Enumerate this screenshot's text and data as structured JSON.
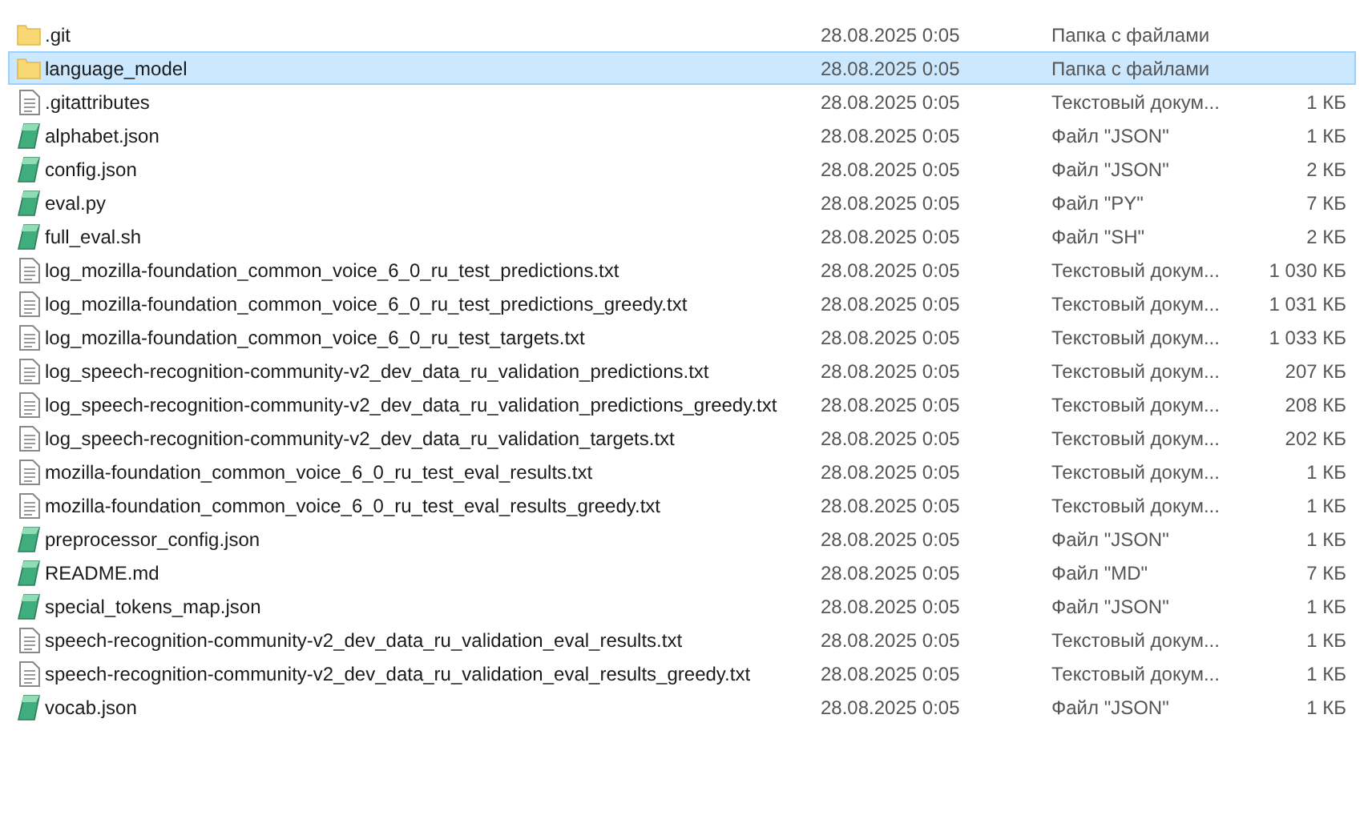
{
  "files": [
    {
      "kind": "folder",
      "name": ".git",
      "date": "28.08.2025 0:05",
      "type": "Папка с файлами",
      "selected": false
    },
    {
      "kind": "folder",
      "name": "language_model",
      "date": "28.08.2025 0:05",
      "type": "Папка с файлами",
      "selected": true
    },
    {
      "kind": "text",
      "name": ".gitattributes",
      "date": "28.08.2025 0:05",
      "type": "Текстовый докум...",
      "size": "1 КБ",
      "selected": false
    },
    {
      "kind": "script",
      "name": "alphabet.json",
      "date": "28.08.2025 0:05",
      "type": "Файл \"JSON\"",
      "size": "1 КБ",
      "selected": false
    },
    {
      "kind": "script",
      "name": "config.json",
      "date": "28.08.2025 0:05",
      "type": "Файл \"JSON\"",
      "size": "2 КБ",
      "selected": false
    },
    {
      "kind": "script",
      "name": "eval.py",
      "date": "28.08.2025 0:05",
      "type": "Файл \"PY\"",
      "size": "7 КБ",
      "selected": false
    },
    {
      "kind": "script",
      "name": "full_eval.sh",
      "date": "28.08.2025 0:05",
      "type": "Файл \"SH\"",
      "size": "2 КБ",
      "selected": false
    },
    {
      "kind": "text",
      "name": "log_mozilla-foundation_common_voice_6_0_ru_test_predictions.txt",
      "date": "28.08.2025 0:05",
      "type": "Текстовый докум...",
      "size": "1 030 КБ",
      "selected": false
    },
    {
      "kind": "text",
      "name": "log_mozilla-foundation_common_voice_6_0_ru_test_predictions_greedy.txt",
      "date": "28.08.2025 0:05",
      "type": "Текстовый докум...",
      "size": "1 031 КБ",
      "selected": false
    },
    {
      "kind": "text",
      "name": "log_mozilla-foundation_common_voice_6_0_ru_test_targets.txt",
      "date": "28.08.2025 0:05",
      "type": "Текстовый докум...",
      "size": "1 033 КБ",
      "selected": false
    },
    {
      "kind": "text",
      "name": "log_speech-recognition-community-v2_dev_data_ru_validation_predictions.txt",
      "date": "28.08.2025 0:05",
      "type": "Текстовый докум...",
      "size": "207 КБ",
      "selected": false
    },
    {
      "kind": "text",
      "name": "log_speech-recognition-community-v2_dev_data_ru_validation_predictions_greedy.txt",
      "date": "28.08.2025 0:05",
      "type": "Текстовый докум...",
      "size": "208 КБ",
      "selected": false
    },
    {
      "kind": "text",
      "name": "log_speech-recognition-community-v2_dev_data_ru_validation_targets.txt",
      "date": "28.08.2025 0:05",
      "type": "Текстовый докум...",
      "size": "202 КБ",
      "selected": false
    },
    {
      "kind": "text",
      "name": "mozilla-foundation_common_voice_6_0_ru_test_eval_results.txt",
      "date": "28.08.2025 0:05",
      "type": "Текстовый докум...",
      "size": "1 КБ",
      "selected": false
    },
    {
      "kind": "text",
      "name": "mozilla-foundation_common_voice_6_0_ru_test_eval_results_greedy.txt",
      "date": "28.08.2025 0:05",
      "type": "Текстовый докум...",
      "size": "1 КБ",
      "selected": false
    },
    {
      "kind": "script",
      "name": "preprocessor_config.json",
      "date": "28.08.2025 0:05",
      "type": "Файл \"JSON\"",
      "size": "1 КБ",
      "selected": false
    },
    {
      "kind": "script",
      "name": "README.md",
      "date": "28.08.2025 0:05",
      "type": "Файл \"MD\"",
      "size": "7 КБ",
      "selected": false
    },
    {
      "kind": "script",
      "name": "special_tokens_map.json",
      "date": "28.08.2025 0:05",
      "type": "Файл \"JSON\"",
      "size": "1 КБ",
      "selected": false
    },
    {
      "kind": "text",
      "name": "speech-recognition-community-v2_dev_data_ru_validation_eval_results.txt",
      "date": "28.08.2025 0:05",
      "type": "Текстовый докум...",
      "size": "1 КБ",
      "selected": false
    },
    {
      "kind": "text",
      "name": "speech-recognition-community-v2_dev_data_ru_validation_eval_results_greedy.txt",
      "date": "28.08.2025 0:05",
      "type": "Текстовый докум...",
      "size": "1 КБ",
      "selected": false
    },
    {
      "kind": "script",
      "name": "vocab.json",
      "date": "28.08.2025 0:05",
      "type": "Файл \"JSON\"",
      "size": "1 КБ",
      "selected": false
    }
  ]
}
